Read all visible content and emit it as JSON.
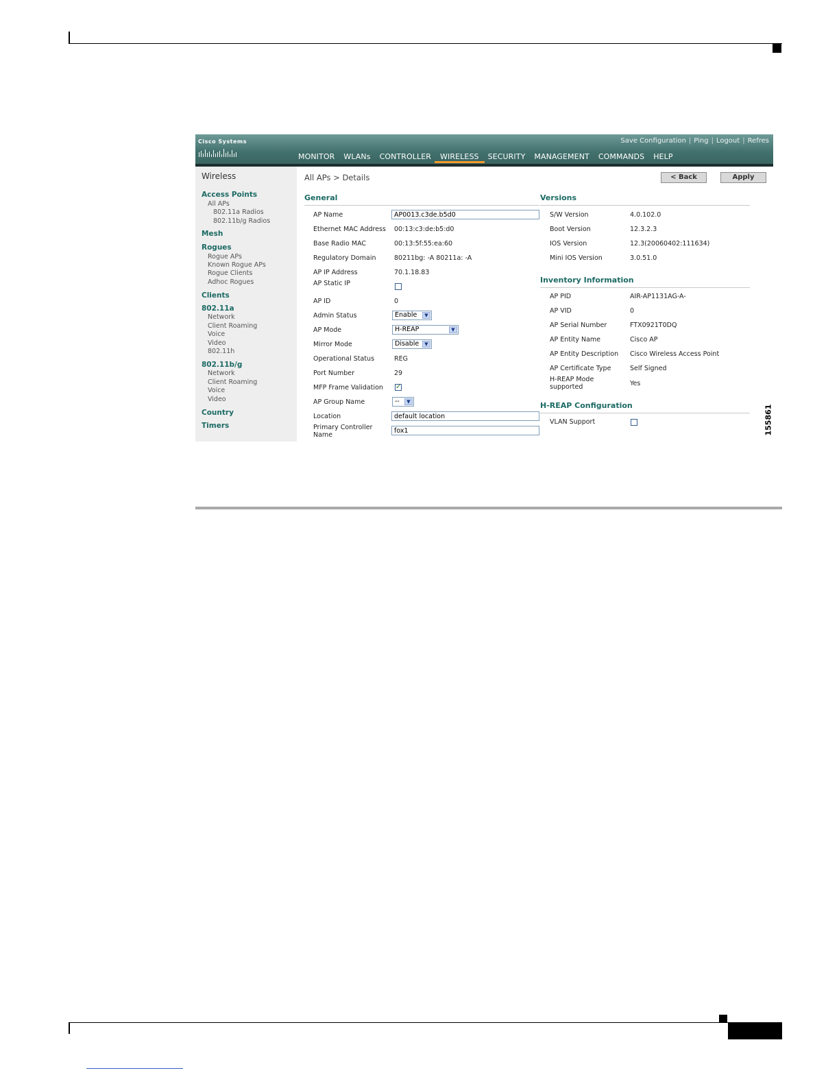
{
  "figure_id": "155861",
  "header": {
    "links": [
      "Save Configuration",
      "Ping",
      "Logout",
      "Refres"
    ],
    "logo_text": "Cisco Systems",
    "nav": [
      "MONITOR",
      "WLANs",
      "CONTROLLER",
      "WIRELESS",
      "SECURITY",
      "MANAGEMENT",
      "COMMANDS",
      "HELP"
    ],
    "active_nav": "WIRELESS"
  },
  "sidebar": {
    "title": "Wireless",
    "sections": [
      {
        "label": "Access Points",
        "items": [
          "All APs",
          "802.11a Radios",
          "802.11b/g Radios"
        ]
      },
      {
        "label": "Mesh",
        "items": []
      },
      {
        "label": "Rogues",
        "items": [
          "Rogue APs",
          "Known Rogue APs",
          "Rogue Clients",
          "Adhoc Rogues"
        ]
      },
      {
        "label": "Clients",
        "items": []
      },
      {
        "label": "802.11a",
        "items": [
          "Network",
          "Client Roaming",
          "Voice",
          "Video",
          "802.11h"
        ]
      },
      {
        "label": "802.11b/g",
        "items": [
          "Network",
          "Client Roaming",
          "Voice",
          "Video"
        ]
      },
      {
        "label": "Country",
        "items": []
      },
      {
        "label": "Timers",
        "items": []
      }
    ]
  },
  "main": {
    "breadcrumb": "All APs > Details",
    "back_label": "< Back",
    "apply_label": "Apply",
    "general": {
      "title": "General",
      "ap_name_label": "AP Name",
      "ap_name_value": "AP0013.c3de.b5d0",
      "eth_mac_label": "Ethernet MAC Address",
      "eth_mac_value": "00:13:c3:de:b5:d0",
      "radio_mac_label": "Base Radio MAC",
      "radio_mac_value": "00:13:5f:55:ea:60",
      "reg_domain_label": "Regulatory Domain",
      "reg_domain_value": "80211bg: -A 80211a: -A",
      "ip_label": "AP IP Address",
      "ip_value": "70.1.18.83",
      "static_ip_label": "AP Static IP",
      "ap_id_label": "AP ID",
      "ap_id_value": "0",
      "admin_status_label": "Admin Status",
      "admin_status_value": "Enable",
      "ap_mode_label": "AP Mode",
      "ap_mode_value": "H-REAP",
      "mirror_mode_label": "Mirror Mode",
      "mirror_mode_value": "Disable",
      "op_status_label": "Operational Status",
      "op_status_value": "REG",
      "port_label": "Port Number",
      "port_value": "29",
      "mfp_label": "MFP Frame Validation",
      "mfp_checked": true,
      "group_label": "AP Group Name",
      "group_value": "--",
      "location_label": "Location",
      "location_value": "default location",
      "primary_label_1": "Primary Controller",
      "primary_label_2": "Name",
      "primary_value": "fox1"
    },
    "versions": {
      "title": "Versions",
      "sw_label": "S/W Version",
      "sw_value": "4.0.102.0",
      "boot_label": "Boot Version",
      "boot_value": "12.3.2.3",
      "ios_label": "IOS Version",
      "ios_value": "12.3(20060402:111634)",
      "mini_label": "Mini IOS Version",
      "mini_value": "3.0.51.0"
    },
    "inventory": {
      "title": "Inventory Information",
      "pid_label": "AP PID",
      "pid_value": "AIR-AP1131AG-A-",
      "vid_label": "AP VID",
      "vid_value": "0",
      "serial_label": "AP Serial Number",
      "serial_value": "FTX0921T0DQ",
      "entity_label": "AP Entity Name",
      "entity_value": "Cisco AP",
      "desc_label": "AP Entity Description",
      "desc_value": "Cisco Wireless Access Point",
      "cert_label": "AP Certificate Type",
      "cert_value": "Self Signed",
      "hreap_label_1": "H-REAP Mode",
      "hreap_label_2": "supported",
      "hreap_value": "Yes"
    },
    "hreap": {
      "title": "H-REAP Configuration",
      "vlan_label": "VLAN Support"
    }
  }
}
